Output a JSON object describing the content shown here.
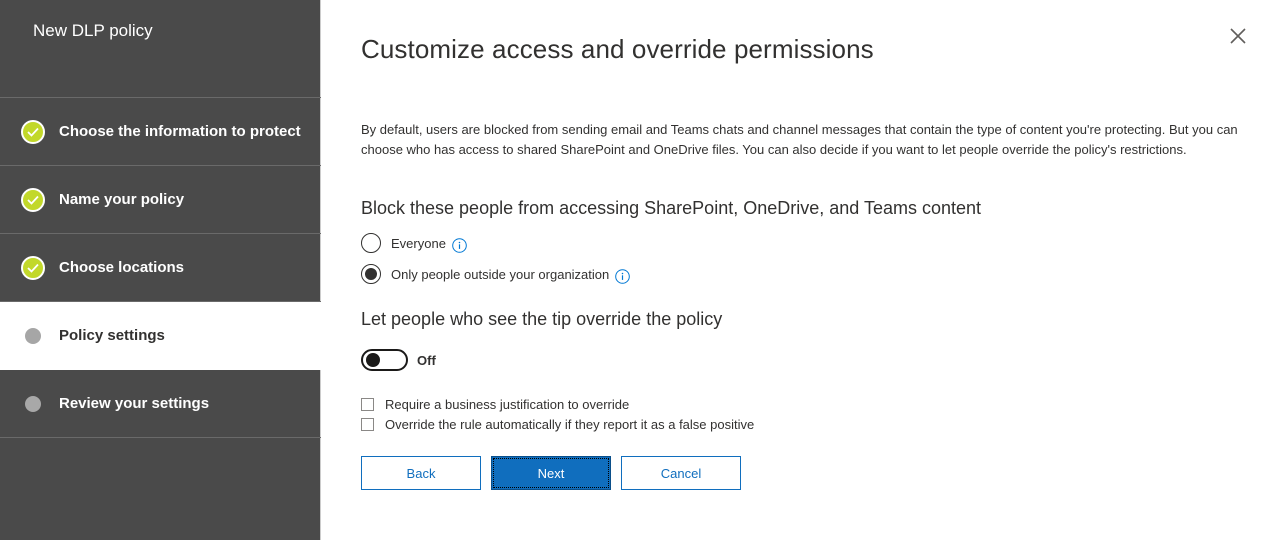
{
  "sidebar": {
    "title": "New DLP policy",
    "steps": [
      {
        "label": "Choose the information to protect",
        "status": "complete"
      },
      {
        "label": "Name your policy",
        "status": "complete"
      },
      {
        "label": "Choose locations",
        "status": "complete"
      },
      {
        "label": "Policy settings",
        "status": "current"
      },
      {
        "label": "Review your settings",
        "status": "pending"
      }
    ]
  },
  "main": {
    "title": "Customize access and override permissions",
    "description": "By default, users are blocked from sending email and Teams chats and channel messages that contain the type of content you're protecting. But you can choose who has access to shared SharePoint and OneDrive files. You can also decide if you want to let people override the policy's restrictions.",
    "block_heading": "Block these people from accessing SharePoint, OneDrive, and Teams content",
    "block_options": [
      {
        "label": "Everyone",
        "selected": false
      },
      {
        "label": "Only people outside your organization",
        "selected": true
      }
    ],
    "override_heading": "Let people who see the tip override the policy",
    "override_toggle": {
      "label": "Off",
      "on": false
    },
    "checkboxes": [
      {
        "label": "Require a business justification to override",
        "checked": false
      },
      {
        "label": "Override the rule automatically if they report it as a false positive",
        "checked": false
      }
    ]
  },
  "buttons": {
    "back": "Back",
    "next": "Next",
    "cancel": "Cancel"
  },
  "colors": {
    "sidebar_bg": "#4a4a4a",
    "check_green": "#c2d82a",
    "primary_blue": "#106ebe",
    "info_blue": "#0078d4"
  }
}
